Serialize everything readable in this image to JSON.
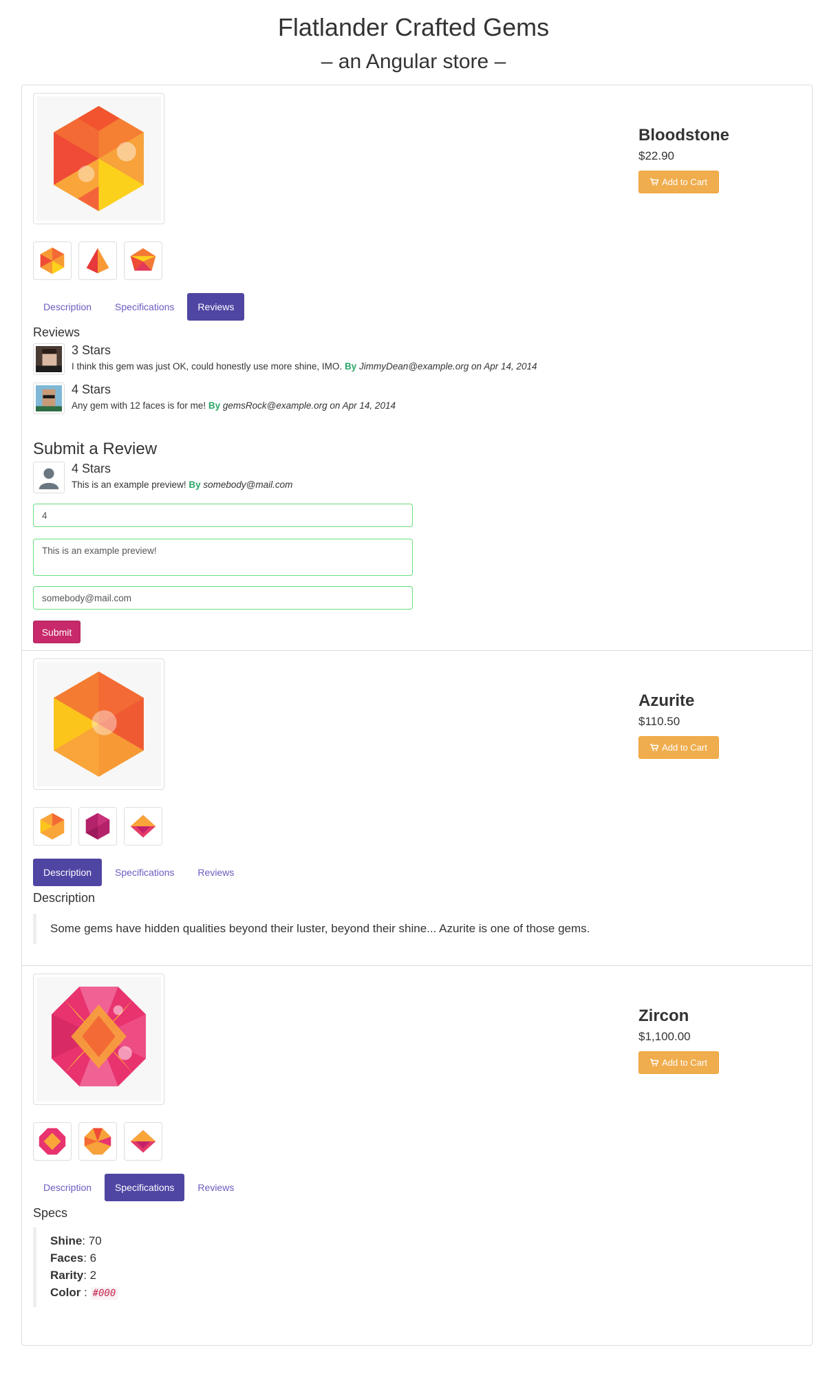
{
  "header": {
    "title": "Flatlander Crafted Gems",
    "subtitle": "– an Angular store –"
  },
  "colors": {
    "tab_active": "#4f45a3",
    "cart_button": "#f0ad4e",
    "submit_button": "#c7296a",
    "review_by": "#2aa66a",
    "valid_field_border": "#66e07a"
  },
  "tabs_labels": [
    "Description",
    "Specifications",
    "Reviews"
  ],
  "cart_label": "Add to Cart",
  "products": [
    {
      "name": "Bloodstone",
      "price": "$22.90",
      "active_tab": "Reviews",
      "reviews_title": "Reviews",
      "reviews": [
        {
          "stars": "3 Stars",
          "body": "I think this gem was just OK, could honestly use more shine, IMO.",
          "by": "By",
          "author": "JimmyDean@example.org on Apr 14, 2014"
        },
        {
          "stars": "4 Stars",
          "body": "Any gem with 12 faces is for me!",
          "by": "By",
          "author": "gemsRock@example.org on Apr 14, 2014"
        }
      ],
      "submit": {
        "title": "Submit a Review",
        "preview_stars": "4 Stars",
        "preview_body": "This is an example preview!",
        "preview_by": "By",
        "preview_author": "somebody@mail.com",
        "stars_value": "4",
        "body_value": "This is an example preview!",
        "author_value": "somebody@mail.com",
        "submit_label": "Submit"
      }
    },
    {
      "name": "Azurite",
      "price": "$110.50",
      "active_tab": "Description",
      "description_title": "Description",
      "description": "Some gems have hidden qualities beyond their luster, beyond their shine... Azurite is one of those gems."
    },
    {
      "name": "Zircon",
      "price": "$1,100.00",
      "active_tab": "Specifications",
      "specs_title": "Specs",
      "specs": {
        "shine_label": "Shine",
        "shine_value": ": 70",
        "faces_label": "Faces",
        "faces_value": ": 6",
        "rarity_label": "Rarity",
        "rarity_value": ": 2",
        "color_label": "Color",
        "color_sep": " : ",
        "color_value": "#000"
      }
    }
  ]
}
